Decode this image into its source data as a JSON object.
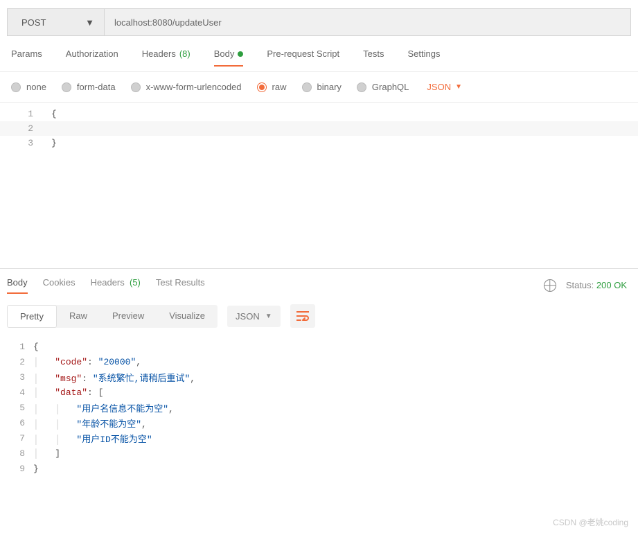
{
  "request": {
    "method": "POST",
    "url": "localhost:8080/updateUser"
  },
  "requestTabs": {
    "params": "Params",
    "authorization": "Authorization",
    "headers": "Headers",
    "headersCount": "(8)",
    "body": "Body",
    "preRequest": "Pre-request Script",
    "tests": "Tests",
    "settings": "Settings",
    "active": "body"
  },
  "bodyTypes": {
    "none": "none",
    "formData": "form-data",
    "xwww": "x-www-form-urlencoded",
    "raw": "raw",
    "binary": "binary",
    "graphql": "GraphQL",
    "selected": "raw",
    "formatLabel": "JSON"
  },
  "requestBody": {
    "line1": "{",
    "line2": "",
    "line3": "}"
  },
  "responseTabs": {
    "body": "Body",
    "cookies": "Cookies",
    "headers": "Headers",
    "headersCount": "(5)",
    "testResults": "Test Results",
    "active": "body"
  },
  "status": {
    "label": "Status:",
    "value": "200 OK"
  },
  "viewBar": {
    "pretty": "Pretty",
    "raw": "Raw",
    "preview": "Preview",
    "visualize": "Visualize",
    "active": "pretty",
    "typeLabel": "JSON"
  },
  "response": {
    "code_key": "\"code\"",
    "code_val": "\"20000\"",
    "msg_key": "\"msg\"",
    "msg_val": "\"系统繁忙,请稍后重试\"",
    "data_key": "\"data\"",
    "arr0": "\"用户名信息不能为空\"",
    "arr1": "\"年龄不能为空\"",
    "arr2": "\"用户ID不能为空\""
  },
  "watermark": "CSDN @老姚coding"
}
